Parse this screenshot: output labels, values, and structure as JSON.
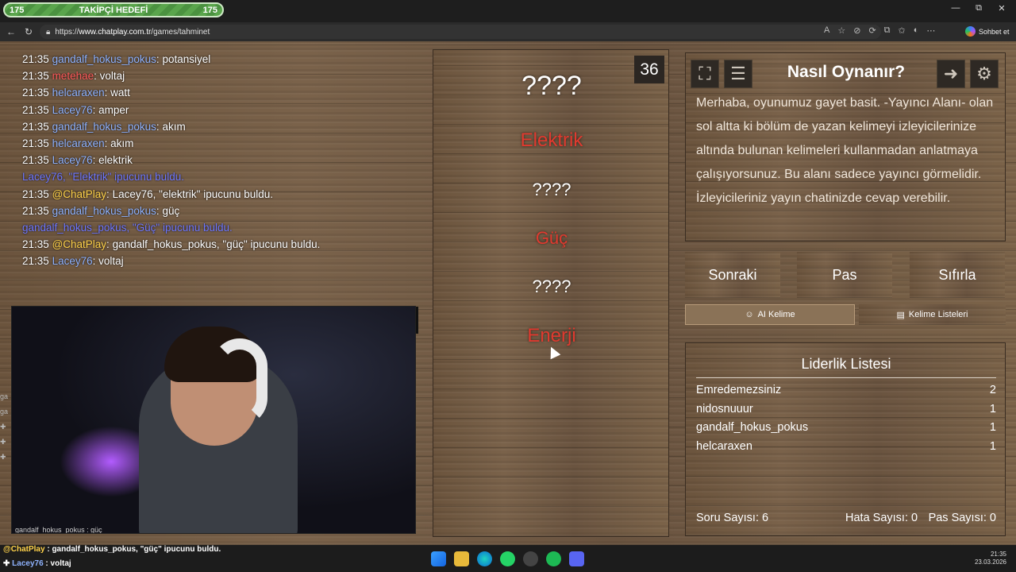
{
  "topbar": {
    "goal_left": "175",
    "goal_label": "TAKİPÇİ HEDEFİ",
    "goal_right": "175",
    "min": "—",
    "max": "⧉",
    "close": "✕"
  },
  "browser": {
    "url_prefix": "https://",
    "url_host": "www.chatplay.com.tr",
    "url_path": "/games/tahminet",
    "sohbet": "Sohbet et"
  },
  "chat": {
    "lines": [
      {
        "time": "21:35",
        "user": "gandalf_hokus_pokus",
        "user_color": "#8fb3ff",
        "text": "potansiyel"
      },
      {
        "time": "21:35",
        "user": "metehae",
        "user_color": "#ff5b5b",
        "text": "voltaj"
      },
      {
        "time": "21:35",
        "user": "helcaraxen",
        "user_color": "#8fb3ff",
        "text": "watt"
      },
      {
        "time": "21:35",
        "user": "Lacey76",
        "user_color": "#8fb3ff",
        "text": "amper"
      },
      {
        "time": "21:35",
        "user": "gandalf_hokus_pokus",
        "user_color": "#8fb3ff",
        "text": "akım"
      },
      {
        "time": "21:35",
        "user": "helcaraxen",
        "user_color": "#8fb3ff",
        "text": "akım"
      },
      {
        "time": "21:35",
        "user": "Lacey76",
        "user_color": "#8fb3ff",
        "text": "elektrik"
      },
      {
        "system": "Lacey76, \"Elektrik\" ipucunu buldu."
      },
      {
        "time": "21:35",
        "user": "@ChatPlay",
        "user_color": "#ffd24a",
        "text": "Lacey76, \"elektrik\" ipucunu buldu."
      },
      {
        "time": "21:35",
        "user": "gandalf_hokus_pokus",
        "user_color": "#8fb3ff",
        "text": "güç"
      },
      {
        "system": "gandalf_hokus_pokus, \"Güç\" ipucunu buldu."
      },
      {
        "time": "21:35",
        "user": "@ChatPlay",
        "user_color": "#ffd24a",
        "text": "gandalf_hokus_pokus, \"güç\" ipucunu buldu."
      },
      {
        "time": "21:35",
        "user": "Lacey76",
        "user_color": "#8fb3ff",
        "text": "voltaj"
      }
    ]
  },
  "webcam_label": "gandalf_hokus_pokus : güç",
  "game": {
    "counter": "36",
    "words": [
      {
        "text": "????",
        "hidden": true,
        "size": 34
      },
      {
        "text": "Elektrik",
        "hidden": false,
        "size": 24
      },
      {
        "text": "????",
        "hidden": true,
        "size": 22
      },
      {
        "text": "Güç",
        "hidden": false,
        "size": 22
      },
      {
        "text": "????",
        "hidden": true,
        "size": 22
      },
      {
        "text": "Enerji",
        "hidden": false,
        "size": 24
      }
    ]
  },
  "howto": {
    "title": "Nasıl Oynanır?",
    "text": "Merhaba, oyunumuz gayet basit. -Yayıncı Alanı- olan sol altta ki bölüm de yazan kelimeyi izleyicilerinize altında bulunan kelimeleri kullanmadan anlatmaya çalışıyorsunuz. Bu alanı sadece yayıncı görmelidir. İzleyicileriniz yayın chatinizde cevap verebilir."
  },
  "controls": {
    "next": "Sonraki",
    "pass": "Pas",
    "reset": "Sıfırla",
    "ai_word": "AI Kelime",
    "word_lists": "Kelime Listeleri"
  },
  "leaderboard": {
    "title": "Liderlik Listesi",
    "rows": [
      {
        "name": "Emredemezsiniz",
        "score": "2"
      },
      {
        "name": "nidosnuuur",
        "score": "1"
      },
      {
        "name": "gandalf_hokus_pokus",
        "score": "1"
      },
      {
        "name": "helcaraxen",
        "score": "1"
      }
    ],
    "soru": "Soru Sayısı: 6",
    "hata": "Hata Sayısı: 0",
    "pas": "Pas Sayısı: 0"
  },
  "taskbar_chat": [
    {
      "user": "@ChatPlay",
      "text": "gandalf_hokus_pokus, \"güç\" ipucunu buldu."
    },
    {
      "user": "Lacey76",
      "text": "voltaj"
    }
  ],
  "clock": {
    "time": "21:35",
    "date": "23.03.2026"
  }
}
